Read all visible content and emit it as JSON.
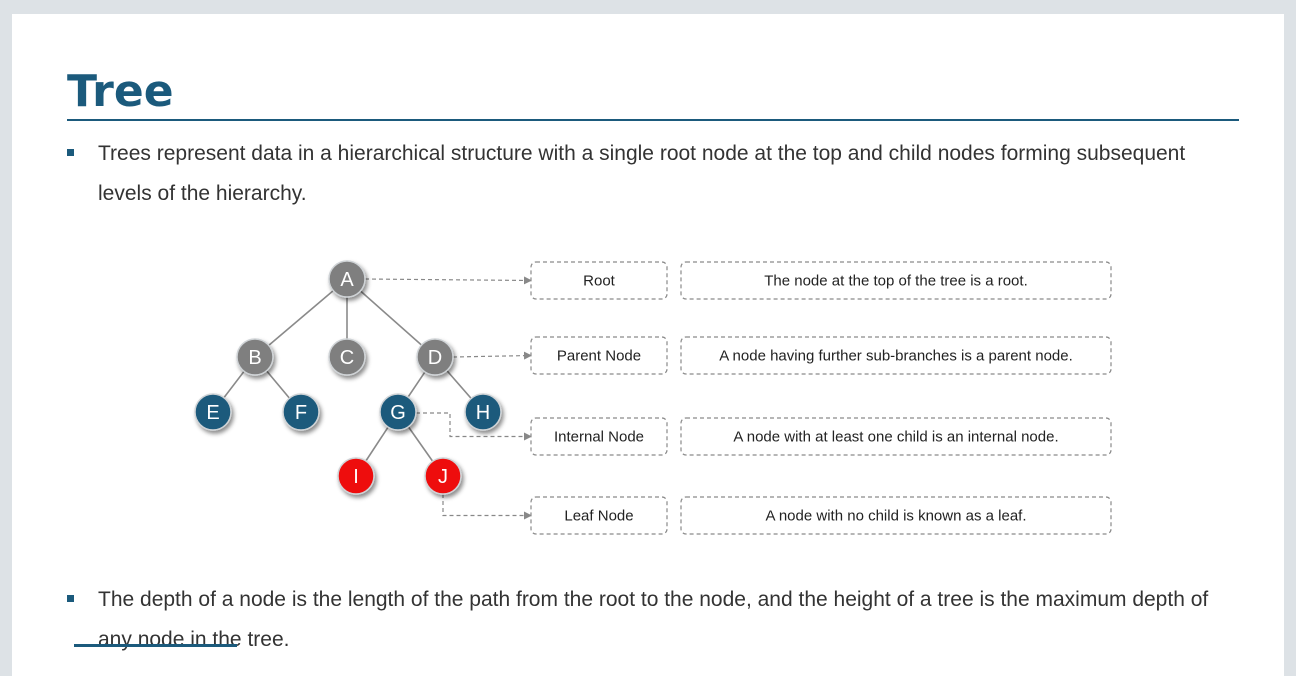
{
  "slide": {
    "title": "Tree",
    "bullets": [
      "Trees represent data in a hierarchical structure with a single root node at the top and child nodes forming subsequent levels of the hierarchy.",
      "The depth of a node is the length of the path from the root to the node, and the height of a tree is the maximum depth of any node in the tree."
    ]
  },
  "tree": {
    "nodes": [
      {
        "id": "A",
        "type": "grey"
      },
      {
        "id": "B",
        "type": "grey"
      },
      {
        "id": "C",
        "type": "grey"
      },
      {
        "id": "D",
        "type": "grey"
      },
      {
        "id": "E",
        "type": "blue"
      },
      {
        "id": "F",
        "type": "blue"
      },
      {
        "id": "G",
        "type": "blue"
      },
      {
        "id": "H",
        "type": "blue"
      },
      {
        "id": "I",
        "type": "red"
      },
      {
        "id": "J",
        "type": "red"
      }
    ],
    "edges": [
      [
        "A",
        "B"
      ],
      [
        "A",
        "C"
      ],
      [
        "A",
        "D"
      ],
      [
        "B",
        "E"
      ],
      [
        "B",
        "F"
      ],
      [
        "D",
        "G"
      ],
      [
        "D",
        "H"
      ],
      [
        "G",
        "I"
      ],
      [
        "G",
        "J"
      ]
    ],
    "colors": {
      "grey": "#7f7f7f",
      "blue": "#1b5a7c",
      "red": "#ee1111"
    }
  },
  "legend": [
    {
      "term": "Root",
      "definition": "The node at the top of the tree is a root.",
      "points_to": "A"
    },
    {
      "term": "Parent Node",
      "definition": "A node having further sub-branches is a parent node.",
      "points_to": "D"
    },
    {
      "term": "Internal Node",
      "definition": "A node with at least one child is an internal node.",
      "points_to": "G"
    },
    {
      "term": "Leaf Node",
      "definition": "A node with no child is known as a leaf.",
      "points_to": "J"
    }
  ]
}
